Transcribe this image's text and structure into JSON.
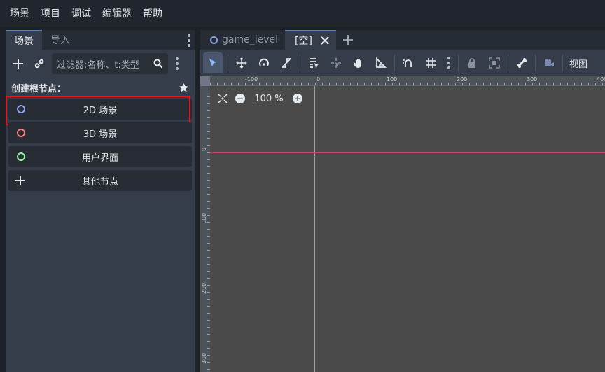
{
  "menu": [
    "场景",
    "项目",
    "调试",
    "编辑器",
    "帮助"
  ],
  "dock": {
    "tabs": [
      "场景",
      "导入"
    ],
    "filter_placeholder": "过滤器:名称、t:类型",
    "create_root_label": "创建根节点：",
    "nodes": [
      {
        "label": "2D 场景",
        "icon": "node2d-icon",
        "color": "#8da5f3"
      },
      {
        "label": "3D 场景",
        "icon": "node3d-icon",
        "color": "#fc7f7f"
      },
      {
        "label": "用户界面",
        "icon": "control-icon",
        "color": "#8eef97"
      },
      {
        "label": "其他节点",
        "icon": "plus-icon",
        "color": "#e0e4ea"
      }
    ]
  },
  "editor": {
    "tabs": [
      {
        "label": "game_level",
        "icon": "node2d-icon"
      },
      {
        "label": "[空]",
        "icon": "close-icon"
      }
    ],
    "view_label": "视图",
    "zoom": "100 %",
    "ruler_top_labels": [
      "-100",
      "0",
      "100",
      "200",
      "300",
      "400"
    ],
    "ruler_left_labels": [
      "0",
      "100",
      "200",
      "300"
    ]
  },
  "colors": {
    "highlight": "#e0161e",
    "axis_x": "#c2476a",
    "axis_y": "#9ab93a",
    "accent": "#577cb0"
  }
}
